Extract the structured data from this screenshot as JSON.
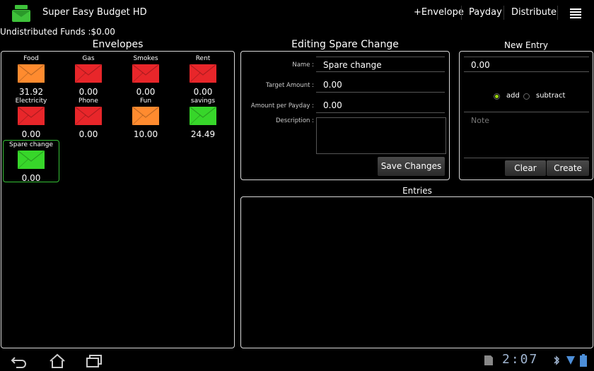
{
  "app": {
    "title": "Super Easy Budget HD",
    "icon": "envelope-app-icon"
  },
  "actions": {
    "add_envelope": "+Envelope",
    "payday": "Payday",
    "distribute": "Distribute",
    "menu_icon": "overflow-menu-icon"
  },
  "undistributed": "Undistributed Funds :$0.00",
  "envelopes_panel": {
    "title": "Envelopes",
    "items": [
      {
        "name": "Food",
        "amount": "31.92",
        "color": "#ff8b2f"
      },
      {
        "name": "Gas",
        "amount": "0.00",
        "color": "#e8262a"
      },
      {
        "name": "Smokes",
        "amount": "0.00",
        "color": "#e8262a"
      },
      {
        "name": "Rent",
        "amount": "0.00",
        "color": "#e8262a"
      },
      {
        "name": "Electricity",
        "amount": "0.00",
        "color": "#e8262a"
      },
      {
        "name": "Phone",
        "amount": "0.00",
        "color": "#e8262a"
      },
      {
        "name": "Fun",
        "amount": "10.00",
        "color": "#ff8b2f"
      },
      {
        "name": "savings",
        "amount": "24.49",
        "color": "#37d62a"
      },
      {
        "name": "Spare change",
        "amount": "0.00",
        "color": "#37d62a"
      }
    ]
  },
  "editing": {
    "title": "Editing Spare Change",
    "name_label": "Name :",
    "name_value": "Spare change",
    "target_label": "Target Amount :",
    "target_value": "0.00",
    "per_payday_label": "Amount per Payday :",
    "per_payday_value": "0.00",
    "description_label": "Description :",
    "description_value": "",
    "save_label": "Save Changes"
  },
  "new_entry": {
    "title": "New Entry",
    "amount_value": "0.00",
    "add_label": "add",
    "subtract_label": "subtract",
    "selected": "add",
    "note_placeholder": "Note",
    "clear_label": "Clear",
    "create_label": "Create"
  },
  "entries": {
    "title": "Entries",
    "items": []
  },
  "system": {
    "clock": "2:07"
  }
}
